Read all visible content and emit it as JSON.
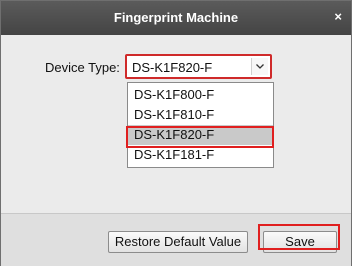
{
  "window": {
    "title": "Fingerprint Machine",
    "close_label": "×"
  },
  "form": {
    "device_type_label": "Device Type:",
    "device_type_value": "DS-K1F820-F"
  },
  "dropdown": {
    "options": [
      {
        "label": "DS-K1F800-F",
        "selected": false
      },
      {
        "label": "DS-K1F810-F",
        "selected": false
      },
      {
        "label": "DS-K1F820-F",
        "selected": true
      },
      {
        "label": "DS-K1F181-F",
        "selected": false
      }
    ]
  },
  "buttons": {
    "restore_label": "Restore Default Value",
    "save_label": "Save"
  },
  "colors": {
    "highlight": "#e01f1f",
    "titlebar": "#4f4f4f"
  }
}
